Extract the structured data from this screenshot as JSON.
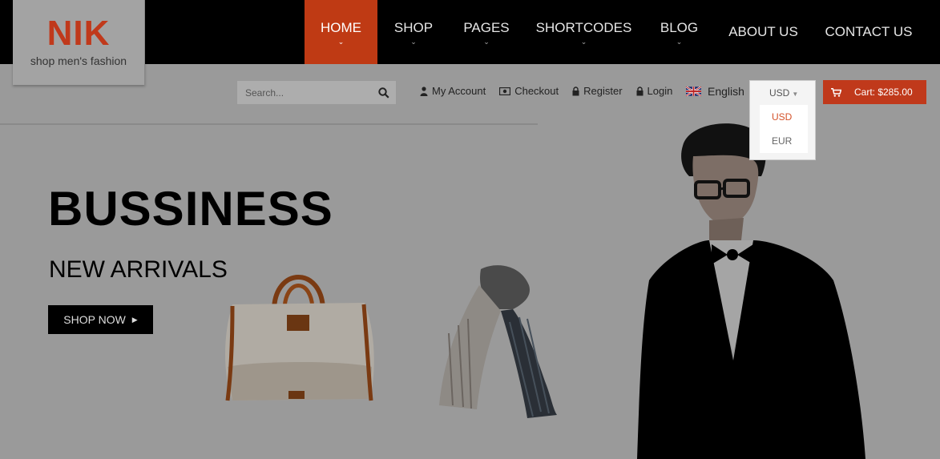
{
  "brand": {
    "name": "NIK",
    "tagline": "shop men's fashion"
  },
  "nav": {
    "items": [
      {
        "label": "HOME",
        "active": true,
        "has_dropdown": true
      },
      {
        "label": "SHOP",
        "has_dropdown": true
      },
      {
        "label": "PAGES",
        "has_dropdown": true
      },
      {
        "label": "SHORTCODES",
        "has_dropdown": true
      },
      {
        "label": "BLOG",
        "has_dropdown": true
      },
      {
        "label": "ABOUT US",
        "has_dropdown": false
      },
      {
        "label": "CONTACT US",
        "has_dropdown": false
      }
    ]
  },
  "search": {
    "placeholder": "Search..."
  },
  "account_links": {
    "my_account": "My Account",
    "checkout": "Checkout",
    "register": "Register",
    "login": "Login"
  },
  "language": {
    "label": "English"
  },
  "currency": {
    "selected": "USD",
    "options": [
      "USD",
      "EUR"
    ]
  },
  "cart": {
    "label": "Cart: $285.00"
  },
  "hero": {
    "title": "BUSSINESS",
    "subtitle": "NEW ARRIVALS",
    "cta": "SHOP NOW"
  },
  "colors": {
    "accent": "#c0391b",
    "nav_bg": "#000000",
    "overlay_bg": "#9a9a9a"
  }
}
